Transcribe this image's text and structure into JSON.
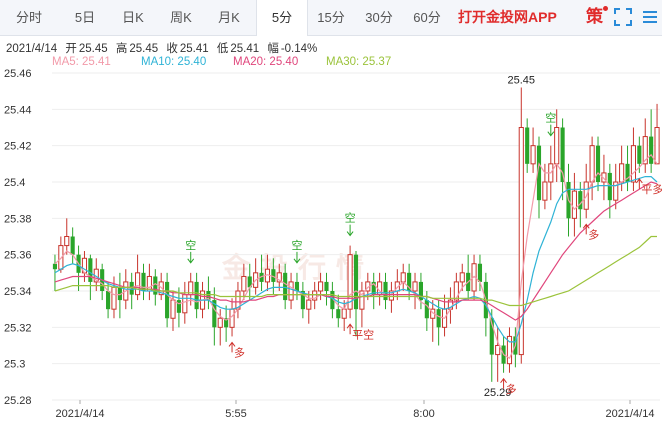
{
  "tabs": [
    {
      "label": "分时",
      "active": false
    },
    {
      "label": "5日",
      "active": false
    },
    {
      "label": "日K",
      "active": false
    },
    {
      "label": "周K",
      "active": false
    },
    {
      "label": "月K",
      "active": false
    },
    {
      "label": "5分",
      "active": true
    },
    {
      "label": "15分",
      "active": false
    },
    {
      "label": "30分",
      "active": false
    },
    {
      "label": "60分",
      "active": false
    }
  ],
  "promo_label": "打开金投网APP",
  "policy_icon_label": "策",
  "ohlc": {
    "date": "2021/4/14",
    "open_label": "开",
    "open": "25.45",
    "high_label": "高",
    "high": "25.45",
    "close_label": "收",
    "close": "25.41",
    "low_label": "低",
    "low": "25.41",
    "change_label": "幅",
    "change": "-0.14%"
  },
  "ma_legend": [
    {
      "label": "MA5: 25.41",
      "color": "#f29aa9"
    },
    {
      "label": "MA10: 25.40",
      "color": "#2fb3d6"
    },
    {
      "label": "MA20: 25.40",
      "color": "#e0467c"
    },
    {
      "label": "MA30: 25.37",
      "color": "#9bc33b"
    }
  ],
  "watermark": "金投行情",
  "colors": {
    "up": "#c8342c",
    "down": "#2aa52a",
    "grid": "#eeeeee"
  },
  "chart_data": {
    "type": "candlestick",
    "y_ticks": [
      "25.46",
      "25.44",
      "25.42",
      "25.4",
      "25.38",
      "25.36",
      "25.34",
      "25.32",
      "25.3",
      "25.28"
    ],
    "ylim": [
      25.28,
      25.46
    ],
    "x_ticks": [
      "2021/4/14",
      "5:55",
      "8:00",
      "2021/4/14"
    ],
    "annotations": [
      {
        "text": "25.45",
        "kind": "high",
        "index": 79,
        "value": 25.452
      },
      {
        "text": "25.29",
        "kind": "low",
        "index": 75,
        "value": 25.29
      }
    ],
    "signals": [
      {
        "text": "空",
        "index": 23,
        "direction": "down"
      },
      {
        "text": "空",
        "index": 41,
        "direction": "down"
      },
      {
        "text": "空",
        "index": 50,
        "direction": "down"
      },
      {
        "text": "空",
        "index": 84,
        "direction": "down"
      },
      {
        "text": "多",
        "index": 30,
        "direction": "up"
      },
      {
        "text": "多",
        "index": 76,
        "direction": "up"
      },
      {
        "text": "多",
        "index": 90,
        "direction": "up"
      },
      {
        "text": "平空",
        "index": 50,
        "direction": "up"
      },
      {
        "text": "平多",
        "index": 99,
        "direction": "up"
      }
    ],
    "candles": [
      [
        25.355,
        25.352,
        25.36,
        25.34
      ],
      [
        25.352,
        25.365,
        25.37,
        25.35
      ],
      [
        25.365,
        25.37,
        25.38,
        25.36
      ],
      [
        25.37,
        25.36,
        25.375,
        25.355
      ],
      [
        25.36,
        25.35,
        25.365,
        25.34
      ],
      [
        25.35,
        25.358,
        25.362,
        25.345
      ],
      [
        25.358,
        25.345,
        25.36,
        25.335
      ],
      [
        25.345,
        25.352,
        25.358,
        25.34
      ],
      [
        25.352,
        25.34,
        25.355,
        25.335
      ],
      [
        25.34,
        25.33,
        25.345,
        25.325
      ],
      [
        25.33,
        25.342,
        25.348,
        25.325
      ],
      [
        25.342,
        25.335,
        25.35,
        25.325
      ],
      [
        25.335,
        25.345,
        25.352,
        25.33
      ],
      [
        25.345,
        25.338,
        25.35,
        25.33
      ],
      [
        25.338,
        25.35,
        25.36,
        25.335
      ],
      [
        25.35,
        25.34,
        25.355,
        25.335
      ],
      [
        25.34,
        25.348,
        25.355,
        25.335
      ],
      [
        25.348,
        25.338,
        25.352,
        25.332
      ],
      [
        25.338,
        25.345,
        25.35,
        25.335
      ],
      [
        25.345,
        25.325,
        25.35,
        25.32
      ],
      [
        25.325,
        25.335,
        25.34,
        25.318
      ],
      [
        25.335,
        25.328,
        25.342,
        25.32
      ],
      [
        25.328,
        25.338,
        25.345,
        25.322
      ],
      [
        25.338,
        25.345,
        25.35,
        25.332
      ],
      [
        25.345,
        25.33,
        25.35,
        25.325
      ],
      [
        25.33,
        25.34,
        25.345,
        25.325
      ],
      [
        25.34,
        25.335,
        25.348,
        25.33
      ],
      [
        25.335,
        25.32,
        25.342,
        25.31
      ],
      [
        25.32,
        25.325,
        25.33,
        25.31
      ],
      [
        25.325,
        25.32,
        25.332,
        25.312
      ],
      [
        25.32,
        25.33,
        25.336,
        25.315
      ],
      [
        25.33,
        25.34,
        25.345,
        25.325
      ],
      [
        25.34,
        25.348,
        25.355,
        25.335
      ],
      [
        25.348,
        25.342,
        25.355,
        25.335
      ],
      [
        25.342,
        25.35,
        25.358,
        25.338
      ],
      [
        25.35,
        25.345,
        25.36,
        25.34
      ],
      [
        25.345,
        25.352,
        25.36,
        25.34
      ],
      [
        25.352,
        25.345,
        25.358,
        25.338
      ],
      [
        25.345,
        25.35,
        25.355,
        25.34
      ],
      [
        25.35,
        25.335,
        25.355,
        25.33
      ],
      [
        25.335,
        25.345,
        25.35,
        25.33
      ],
      [
        25.345,
        25.34,
        25.35,
        25.335
      ],
      [
        25.34,
        25.33,
        25.345,
        25.325
      ],
      [
        25.33,
        25.335,
        25.34,
        25.322
      ],
      [
        25.335,
        25.34,
        25.345,
        25.33
      ],
      [
        25.34,
        25.345,
        25.35,
        25.335
      ],
      [
        25.345,
        25.34,
        25.35,
        25.332
      ],
      [
        25.34,
        25.33,
        25.345,
        25.325
      ],
      [
        25.33,
        25.325,
        25.338,
        25.32
      ],
      [
        25.325,
        25.33,
        25.335,
        25.318
      ],
      [
        25.33,
        25.36,
        25.365,
        25.325
      ],
      [
        25.36,
        25.33,
        25.362,
        25.315
      ],
      [
        25.33,
        25.34,
        25.345,
        25.32
      ],
      [
        25.34,
        25.345,
        25.35,
        25.335
      ],
      [
        25.345,
        25.338,
        25.35,
        25.33
      ],
      [
        25.338,
        25.345,
        25.35,
        25.332
      ],
      [
        25.345,
        25.335,
        25.35,
        25.33
      ],
      [
        25.335,
        25.34,
        25.345,
        25.328
      ],
      [
        25.34,
        25.345,
        25.352,
        25.335
      ],
      [
        25.345,
        25.35,
        25.355,
        25.34
      ],
      [
        25.35,
        25.34,
        25.355,
        25.335
      ],
      [
        25.34,
        25.345,
        25.35,
        25.33
      ],
      [
        25.345,
        25.335,
        25.35,
        25.33
      ],
      [
        25.335,
        25.325,
        25.34,
        25.318
      ],
      [
        25.325,
        25.33,
        25.335,
        25.312
      ],
      [
        25.33,
        25.32,
        25.335,
        25.31
      ],
      [
        25.32,
        25.33,
        25.338,
        25.315
      ],
      [
        25.33,
        25.335,
        25.342,
        25.322
      ],
      [
        25.335,
        25.345,
        25.35,
        25.33
      ],
      [
        25.345,
        25.35,
        25.355,
        25.34
      ],
      [
        25.35,
        25.34,
        25.36,
        25.335
      ],
      [
        25.34,
        25.355,
        25.36,
        25.335
      ],
      [
        25.355,
        25.345,
        25.36,
        25.34
      ],
      [
        25.345,
        25.325,
        25.35,
        25.315
      ],
      [
        25.325,
        25.305,
        25.33,
        25.29
      ],
      [
        25.305,
        25.31,
        25.32,
        25.29
      ],
      [
        25.31,
        25.3,
        25.315,
        25.295
      ],
      [
        25.3,
        25.315,
        25.32,
        25.295
      ],
      [
        25.315,
        25.305,
        25.32,
        25.298
      ],
      [
        25.305,
        25.43,
        25.452,
        25.3
      ],
      [
        25.43,
        25.41,
        25.435,
        25.405
      ],
      [
        25.41,
        25.42,
        25.43,
        25.405
      ],
      [
        25.42,
        25.39,
        25.425,
        25.38
      ],
      [
        25.39,
        25.4,
        25.41,
        25.385
      ],
      [
        25.4,
        25.41,
        25.42,
        25.39
      ],
      [
        25.41,
        25.43,
        25.44,
        25.4
      ],
      [
        25.43,
        25.4,
        25.435,
        25.39
      ],
      [
        25.4,
        25.38,
        25.41,
        25.37
      ],
      [
        25.38,
        25.395,
        25.405,
        25.37
      ],
      [
        25.395,
        25.385,
        25.4,
        25.375
      ],
      [
        25.385,
        25.4,
        25.41,
        25.38
      ],
      [
        25.4,
        25.42,
        25.425,
        25.39
      ],
      [
        25.42,
        25.4,
        25.425,
        25.395
      ],
      [
        25.4,
        25.405,
        25.415,
        25.39
      ],
      [
        25.405,
        25.39,
        25.41,
        25.38
      ],
      [
        25.39,
        25.4,
        25.41,
        25.385
      ],
      [
        25.4,
        25.41,
        25.42,
        25.395
      ],
      [
        25.41,
        25.4,
        25.42,
        25.395
      ],
      [
        25.4,
        25.42,
        25.43,
        25.395
      ],
      [
        25.42,
        25.41,
        25.425,
        25.405
      ],
      [
        25.41,
        25.425,
        25.435,
        25.405
      ],
      [
        25.425,
        25.41,
        25.44,
        25.405
      ],
      [
        25.41,
        25.43,
        25.443,
        25.41
      ]
    ],
    "ma": {
      "MA5": [
        25.355,
        25.358,
        25.362,
        25.36,
        25.355,
        25.35,
        25.348,
        25.346,
        25.344,
        25.34,
        25.338,
        25.338,
        25.34,
        25.342,
        25.343,
        25.342,
        25.342,
        25.344,
        25.342,
        25.338,
        25.335,
        25.333,
        25.334,
        25.335,
        25.334,
        25.335,
        25.336,
        25.33,
        25.326,
        25.324,
        25.326,
        25.33,
        25.336,
        25.342,
        25.346,
        25.348,
        25.349,
        25.348,
        25.346,
        25.344,
        25.342,
        25.34,
        25.338,
        25.336,
        25.336,
        25.338,
        25.338,
        25.336,
        25.332,
        25.33,
        25.338,
        25.34,
        25.338,
        25.342,
        25.344,
        25.34,
        25.338,
        25.338,
        25.342,
        25.345,
        25.342,
        25.338,
        25.334,
        25.332,
        25.328,
        25.326,
        25.325,
        25.33,
        25.336,
        25.342,
        25.345,
        25.348,
        25.345,
        25.335,
        25.322,
        25.312,
        25.305,
        25.303,
        25.31,
        25.345,
        25.37,
        25.39,
        25.41,
        25.405,
        25.405,
        25.41,
        25.405,
        25.39,
        25.385,
        25.388,
        25.392,
        25.4,
        25.405,
        25.402,
        25.398,
        25.398,
        25.4,
        25.402,
        25.405,
        25.408,
        25.412,
        25.415,
        25.41
      ],
      "MA10": [
        25.35,
        25.352,
        25.354,
        25.355,
        25.354,
        25.352,
        25.35,
        25.348,
        25.346,
        25.344,
        25.343,
        25.342,
        25.341,
        25.341,
        25.341,
        25.34,
        25.34,
        25.34,
        25.339,
        25.338,
        25.337,
        25.336,
        25.336,
        25.336,
        25.335,
        25.335,
        25.335,
        25.333,
        25.331,
        25.33,
        25.33,
        25.331,
        25.333,
        25.335,
        25.337,
        25.339,
        25.341,
        25.342,
        25.342,
        25.342,
        25.341,
        25.34,
        25.339,
        25.338,
        25.338,
        25.338,
        25.337,
        25.336,
        25.334,
        25.333,
        25.334,
        25.336,
        25.337,
        25.338,
        25.339,
        25.339,
        25.339,
        25.339,
        25.34,
        25.341,
        25.34,
        25.339,
        25.337,
        25.335,
        25.333,
        25.331,
        25.33,
        25.331,
        25.333,
        25.335,
        25.336,
        25.337,
        25.336,
        25.332,
        25.326,
        25.32,
        25.315,
        25.312,
        25.312,
        25.322,
        25.335,
        25.35,
        25.362,
        25.37,
        25.378,
        25.388,
        25.394,
        25.396,
        25.396,
        25.396,
        25.396,
        25.397,
        25.398,
        25.398,
        25.398,
        25.398,
        25.399,
        25.4,
        25.401,
        25.402,
        25.403,
        25.403,
        25.4
      ],
      "MA20": [
        25.345,
        25.346,
        25.347,
        25.348,
        25.348,
        25.348,
        25.348,
        25.347,
        25.346,
        25.345,
        25.344,
        25.343,
        25.342,
        25.342,
        25.342,
        25.341,
        25.341,
        25.341,
        25.34,
        25.34,
        25.339,
        25.339,
        25.338,
        25.338,
        25.338,
        25.337,
        25.337,
        25.336,
        25.335,
        25.335,
        25.334,
        25.334,
        25.334,
        25.335,
        25.335,
        25.336,
        25.337,
        25.337,
        25.338,
        25.338,
        25.338,
        25.338,
        25.338,
        25.338,
        25.338,
        25.338,
        25.337,
        25.337,
        25.336,
        25.336,
        25.336,
        25.336,
        25.337,
        25.337,
        25.338,
        25.338,
        25.338,
        25.338,
        25.338,
        25.338,
        25.338,
        25.338,
        25.337,
        25.337,
        25.336,
        25.335,
        25.334,
        25.334,
        25.334,
        25.335,
        25.335,
        25.335,
        25.335,
        25.334,
        25.332,
        25.33,
        25.328,
        25.326,
        25.324,
        25.326,
        25.33,
        25.335,
        25.34,
        25.345,
        25.35,
        25.355,
        25.36,
        25.364,
        25.368,
        25.372,
        25.375,
        25.378,
        25.381,
        25.384,
        25.386,
        25.388,
        25.39,
        25.392,
        25.394,
        25.396,
        25.398,
        25.4,
        25.399
      ],
      "MA30": [
        25.34,
        25.341,
        25.342,
        25.343,
        25.343,
        25.343,
        25.343,
        25.343,
        25.343,
        25.343,
        25.342,
        25.342,
        25.342,
        25.342,
        25.341,
        25.341,
        25.341,
        25.34,
        25.34,
        25.34,
        25.34,
        25.339,
        25.339,
        25.339,
        25.339,
        25.338,
        25.338,
        25.338,
        25.337,
        25.337,
        25.337,
        25.337,
        25.337,
        25.337,
        25.337,
        25.337,
        25.338,
        25.338,
        25.338,
        25.338,
        25.338,
        25.338,
        25.338,
        25.338,
        25.338,
        25.338,
        25.338,
        25.338,
        25.337,
        25.337,
        25.337,
        25.337,
        25.337,
        25.337,
        25.337,
        25.337,
        25.337,
        25.337,
        25.337,
        25.337,
        25.337,
        25.337,
        25.337,
        25.337,
        25.336,
        25.336,
        25.336,
        25.336,
        25.336,
        25.336,
        25.336,
        25.336,
        25.336,
        25.335,
        25.335,
        25.334,
        25.333,
        25.332,
        25.332,
        25.332,
        25.333,
        25.334,
        25.335,
        25.336,
        25.337,
        25.338,
        25.339,
        25.34,
        25.342,
        25.344,
        25.346,
        25.348,
        25.35,
        25.352,
        25.354,
        25.356,
        25.358,
        25.36,
        25.362,
        25.364,
        25.367,
        25.37,
        25.37
      ]
    }
  }
}
